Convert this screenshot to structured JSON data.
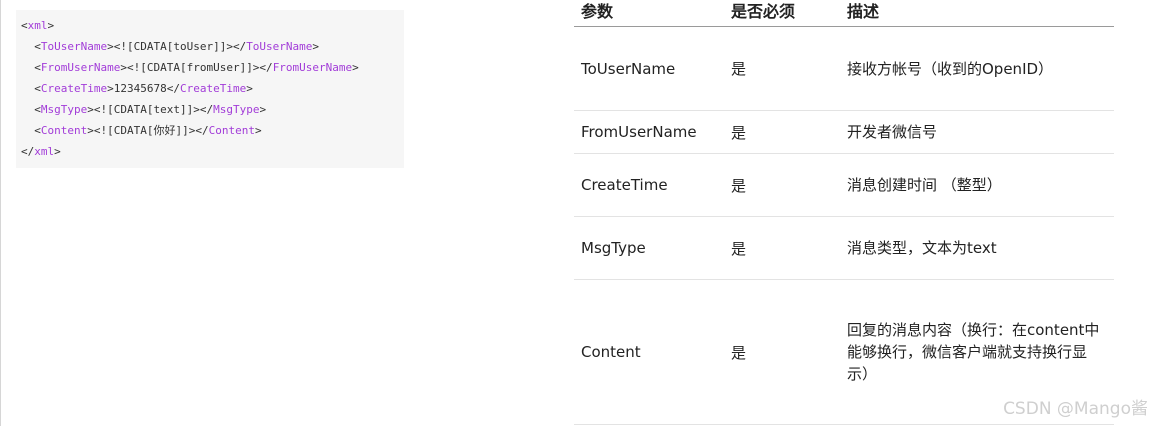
{
  "code": {
    "lines": [
      {
        "indent": "",
        "pre": "<",
        "tag1": "xml",
        "mid": ">",
        "tag2": "",
        "post": ""
      },
      {
        "indent": "  ",
        "pre": "<",
        "tag1": "ToUserName",
        "mid": "><![CDATA[toUser]]></",
        "tag2": "ToUserName",
        "post": ">"
      },
      {
        "indent": "  ",
        "pre": "<",
        "tag1": "FromUserName",
        "mid": "><![CDATA[fromUser]]></",
        "tag2": "FromUserName",
        "post": ">"
      },
      {
        "indent": "  ",
        "pre": "<",
        "tag1": "CreateTime",
        "mid": ">12345678</",
        "tag2": "CreateTime",
        "post": ">"
      },
      {
        "indent": "  ",
        "pre": "<",
        "tag1": "MsgType",
        "mid": "><![CDATA[text]]></",
        "tag2": "MsgType",
        "post": ">"
      },
      {
        "indent": "  ",
        "pre": "<",
        "tag1": "Content",
        "mid": "><![CDATA[你好]]></",
        "tag2": "Content",
        "post": ">"
      },
      {
        "indent": "",
        "pre": "</",
        "tag1": "xml",
        "mid": ">",
        "tag2": "",
        "post": ""
      }
    ]
  },
  "table": {
    "headers": [
      "参数",
      "是否必须",
      "描述"
    ],
    "rows": [
      {
        "param": "ToUserName",
        "required": "是",
        "desc": "接收方帐号（收到的OpenID）"
      },
      {
        "param": "FromUserName",
        "required": "是",
        "desc": "开发者微信号"
      },
      {
        "param": "CreateTime",
        "required": "是",
        "desc": "消息创建时间 （整型）"
      },
      {
        "param": "MsgType",
        "required": "是",
        "desc": "消息类型，文本为text"
      },
      {
        "param": "Content",
        "required": "是",
        "desc": "回复的消息内容（换行：在content中能够换行，微信客户端就支持换行显示）"
      }
    ]
  },
  "watermark": "CSDN @Mango酱",
  "colors": {
    "tag": "#a23cd8",
    "code_bg": "#f6f6f6"
  }
}
